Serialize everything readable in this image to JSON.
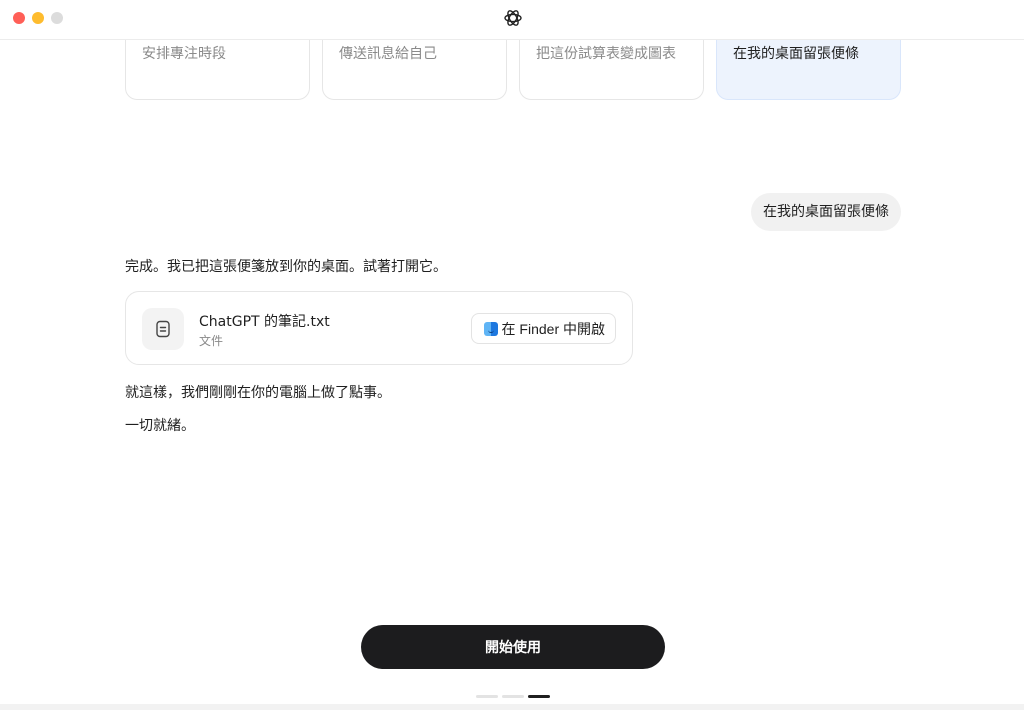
{
  "window": {
    "controls": [
      "close",
      "minimize",
      "maximize"
    ],
    "logo_icon": "openai-logo-icon"
  },
  "suggestions": [
    {
      "label": "安排專注時段",
      "active": false
    },
    {
      "label": "傳送訊息給自己",
      "active": false
    },
    {
      "label": "把這份試算表變成圖表",
      "active": false
    },
    {
      "label": "在我的桌面留張便條",
      "active": true
    }
  ],
  "conversation": {
    "user_message": "在我的桌面留張便條",
    "assistant_intro": "完成。我已把這張便箋放到你的桌面。試著打開它。",
    "file": {
      "icon": "document-icon",
      "name": "ChatGPT 的筆記.txt",
      "type": "文件",
      "action_label": "在 Finder 中開啟",
      "action_icon": "finder-icon"
    },
    "assistant_after": "就這樣，我們剛剛在你的電腦上做了點事。",
    "assistant_final": "一切就緒。"
  },
  "footer": {
    "start_label": "開始使用",
    "pager": {
      "total": 3,
      "current": 3
    }
  },
  "colors": {
    "accent_bg": "#edf3fd",
    "primary_button": "#1c1c1e",
    "close": "#ff5f57",
    "minimize": "#febc2e"
  }
}
